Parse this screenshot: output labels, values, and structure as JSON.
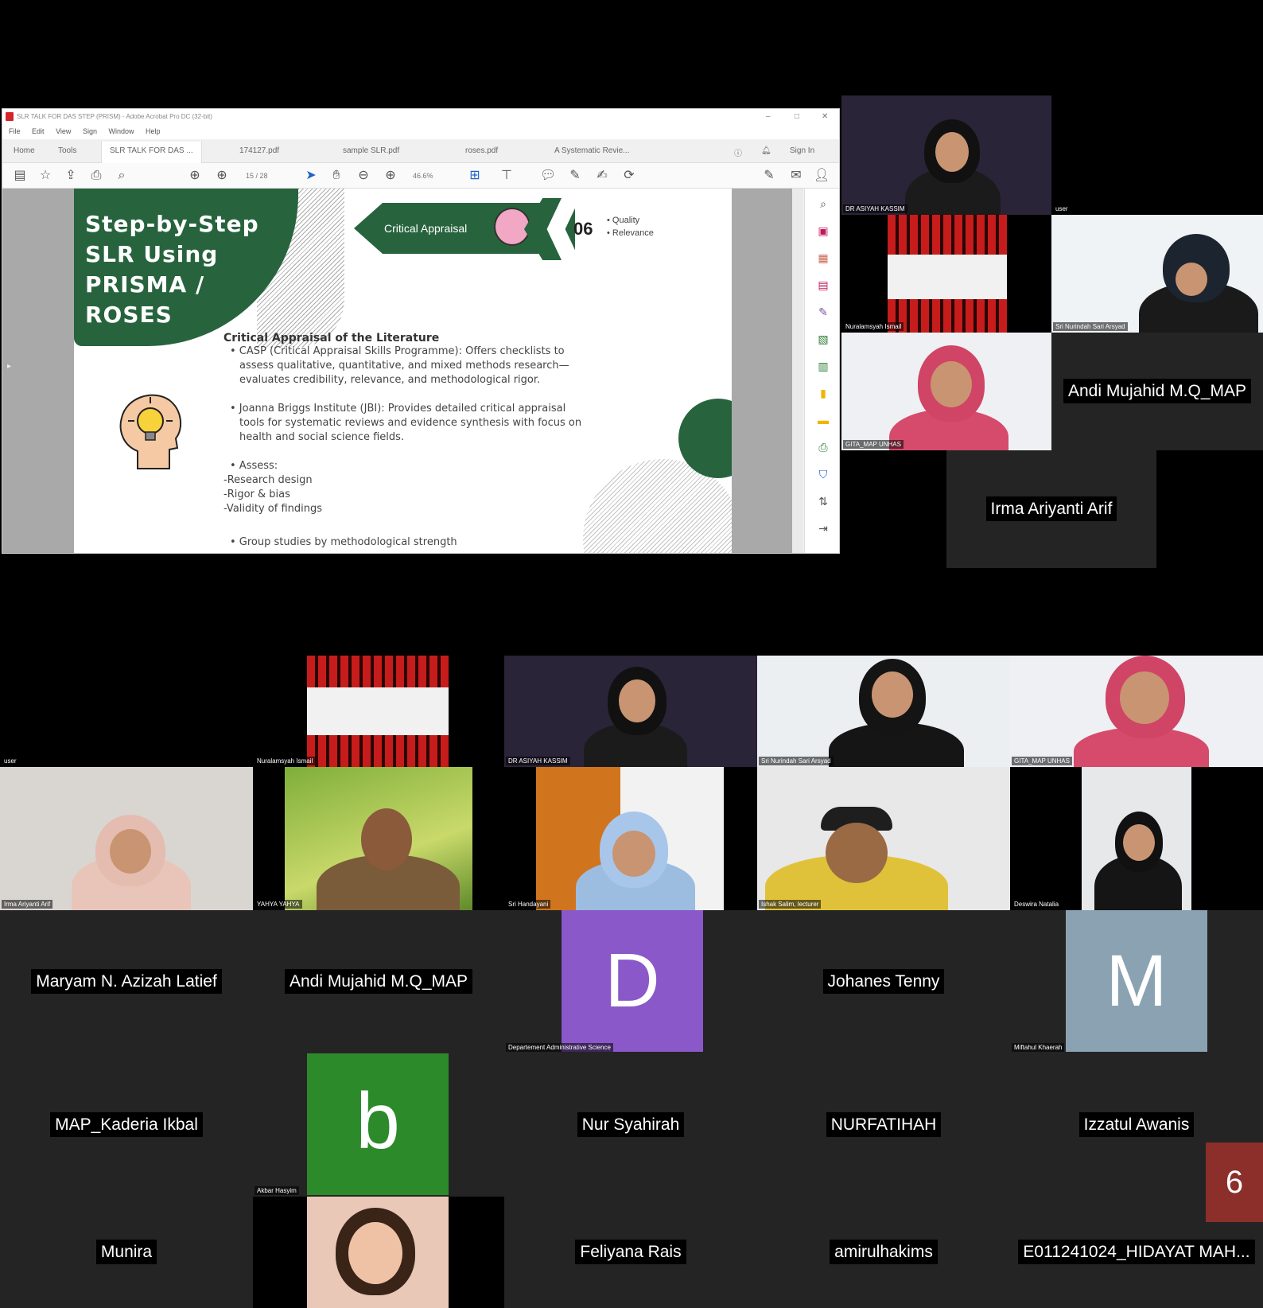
{
  "acrobat": {
    "window_title": "SLR TALK FOR DAS STEP (PRISM) - Adobe Acrobat Pro DC (32-bit)",
    "menu": [
      "File",
      "Edit",
      "View",
      "Sign",
      "Window",
      "Help"
    ],
    "tabs": [
      "Home",
      "Tools",
      "SLR TALK FOR DAS ...",
      "174127.pdf",
      "sample SLR.pdf",
      "roses.pdf",
      "A Systematic Revie..."
    ],
    "sign_in": "Sign In",
    "page_indicator": "15 / 28",
    "zoom": "46.6%"
  },
  "slide": {
    "title_lines": [
      "Step-by-Step",
      "SLR Using",
      "PRISMA /",
      "ROSES"
    ],
    "banner": "Critical Appraisal",
    "step_number": "06",
    "bullets_top": [
      "• Quality",
      "• Relevance"
    ],
    "section_title": "Critical Appraisal of the Literature",
    "casp": [
      "• CASP (Critical Appraisal Skills Programme): Offers checklists to",
      "assess qualitative, quantitative, and mixed methods research—",
      "evaluates credibility, relevance, and methodological rigor."
    ],
    "jbi": [
      "• Joanna Briggs Institute (JBI): Provides detailed critical appraisal",
      "tools for systematic reviews and evidence synthesis with focus on",
      "health and social science fields."
    ],
    "assess": [
      "• Assess:",
      "-Research design",
      "-Rigor & bias",
      "-Validity of findings"
    ],
    "group": "• Group studies by methodological strength"
  },
  "top_tiles": {
    "t1": "DR ASIYAH KASSIM",
    "t1b": "user",
    "t2": "Nuralamsyah Ismail",
    "t3": "Sri Nurindah Sari Arsyad",
    "t4": "GITA_MAP UNHAS",
    "n1": "Andi Mujahid M.Q_MAP",
    "n2": "Irma Ariyanti Arif"
  },
  "grid": {
    "r1": [
      "user",
      "Nuralamsyah Ismail",
      "DR ASIYAH KASSIM",
      "Sri Nurindah Sari Arsyad",
      "GITA_MAP UNHAS"
    ],
    "r2": [
      "Irma Ariyanti Arif",
      "YAHYA YAHYA",
      "Sri Handayani",
      "Ishak Salim, lecturer",
      "Deswira Natalia"
    ],
    "r3": [
      "Maryam N. Azizah Latief",
      "Andi Mujahid M.Q_MAP",
      "Departement Administrative Science",
      "Johanes Tenny",
      "Miftahul Khaerah"
    ],
    "r4": [
      "MAP_Kaderia Ikbal",
      "Akbar Hasyim",
      "Nur Syahirah",
      "NURFATIHAH",
      "Izzatul Awanis"
    ],
    "r5": [
      "Munira",
      "Feliyana Rais",
      "amirulhakims",
      "E011241024_HIDAYAT MAH..."
    ]
  },
  "avatars": {
    "d": "D",
    "m": "M",
    "b": "b"
  },
  "colors": {
    "slide_green": "#27643e",
    "avatar_purple": "#8a58c8",
    "avatar_gray": "#8aa2b2",
    "avatar_green": "#2d8a2a",
    "badge": "#8c2f2b"
  },
  "page_badge": "6"
}
